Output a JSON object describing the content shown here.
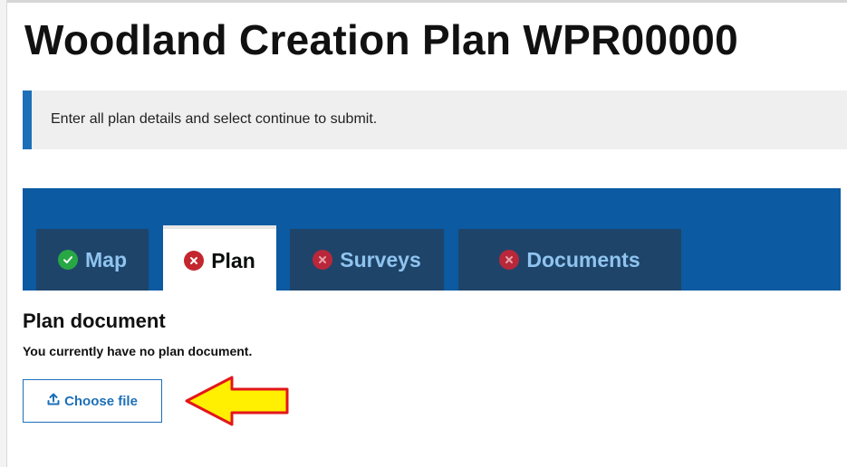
{
  "page": {
    "title": "Woodland Creation Plan WPR00000",
    "inset_text": "Enter all plan details and select continue to submit."
  },
  "tabs": [
    {
      "label": "Map",
      "status": "complete",
      "active": false
    },
    {
      "label": "Plan",
      "status": "incomplete",
      "active": true
    },
    {
      "label": "Surveys",
      "status": "incomplete",
      "active": false
    },
    {
      "label": "Documents",
      "status": "incomplete",
      "active": false
    }
  ],
  "plan_section": {
    "heading": "Plan document",
    "message": "You currently have no plan document.",
    "button_label": "Choose file",
    "button_icon": "upload-icon"
  },
  "icons": {
    "complete": "check-circle-icon",
    "incomplete": "cross-circle-icon",
    "annotation": "yellow-arrow-pointing-left"
  },
  "colors": {
    "brand_blue": "#1d70b8",
    "tab_band": "#0b5aa2",
    "tab_inactive_bg": "#1f4469",
    "tab_inactive_text": "#8fc4ef",
    "complete_green": "#28a745",
    "incomplete_red": "#c4262e",
    "arrow_fill": "#ffef00",
    "arrow_outline": "#e3161b"
  }
}
